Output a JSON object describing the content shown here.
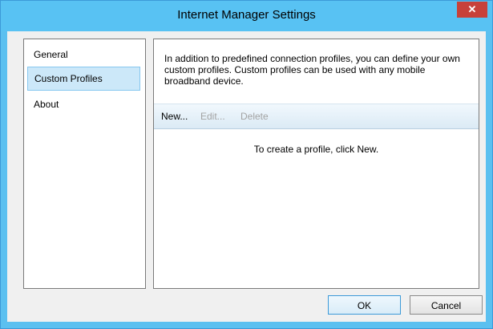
{
  "window": {
    "title": "Internet Manager Settings",
    "close_glyph": "✕"
  },
  "nav": {
    "items": [
      {
        "label": "General",
        "selected": false
      },
      {
        "label": "Custom Profiles",
        "selected": true
      },
      {
        "label": "About",
        "selected": false
      }
    ]
  },
  "content": {
    "description": "In addition to predefined connection profiles, you can define your own custom profiles. Custom profiles can be used with any mobile broadband device.",
    "toolbar": {
      "new_label": "New...",
      "edit_label": "Edit...",
      "delete_label": "Delete"
    },
    "empty_message": "To create a profile, click New."
  },
  "footer": {
    "ok_label": "OK",
    "cancel_label": "Cancel"
  },
  "colors": {
    "titlebar": "#58c2f3",
    "close": "#c7413a",
    "selection": "#cce8f9"
  }
}
